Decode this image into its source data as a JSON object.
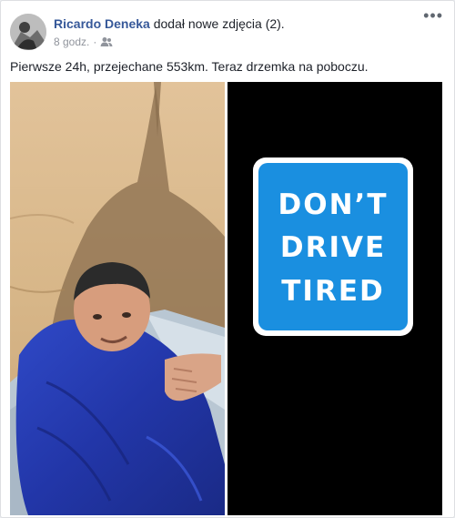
{
  "post": {
    "author_name": "Ricardo Deneka",
    "action_text": " dodał nowe zdjęcia (2).",
    "timestamp": "8 godz.",
    "audience_icon": "friends-icon",
    "separator": "·",
    "options_label": "•••",
    "text": "Pierwsze 24h, przejechane 553km. Teraz drzemka na poboczu."
  },
  "photos": [
    {
      "name": "selfie-in-sleeping-bag"
    },
    {
      "name": "road-sign-photo",
      "sign_lines": [
        "DON’T",
        "DRIVE",
        "TIRED"
      ]
    }
  ],
  "colors": {
    "link": "#365899",
    "meta": "#90949c",
    "sign_blue": "#1a8fe0"
  }
}
